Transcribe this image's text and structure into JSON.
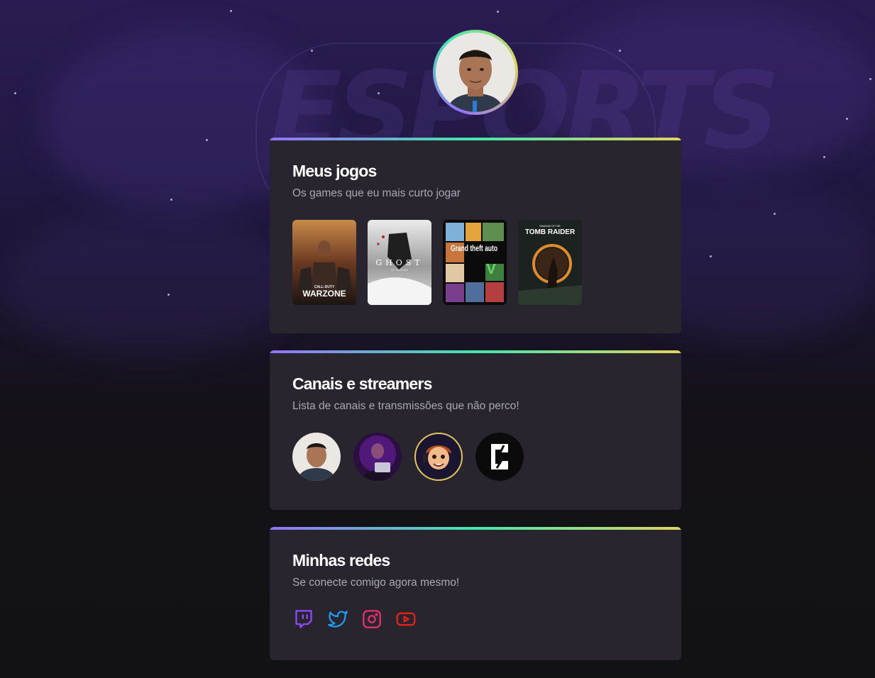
{
  "profile": {
    "avatar_alt": ""
  },
  "games_card": {
    "title": "Meus jogos",
    "subtitle": "Os games que eu mais curto jogar",
    "games": [
      {
        "cover_text": "WARZONE",
        "cover_subtext": "CALL·DUTY"
      },
      {
        "cover_text": "GHOST",
        "cover_subtext": "OF TSUSHIMA"
      },
      {
        "cover_text": "Grand theft auto",
        "cover_subtext": "V"
      },
      {
        "cover_text": "TOMB RAIDER",
        "cover_subtext": "SHADOW OF THE"
      }
    ]
  },
  "channels_card": {
    "title": "Canais e streamers",
    "subtitle": "Lista de canais e transmissões que não perco!"
  },
  "socials_card": {
    "title": "Minhas redes",
    "subtitle": "Se conecte comigo agora mesmo!",
    "icons": [
      "twitch-icon",
      "twitter-icon",
      "instagram-icon",
      "youtube-icon"
    ]
  },
  "colors": {
    "accent_gradient": [
      "#9572fc",
      "#43e7ad",
      "#e1d55d"
    ],
    "card_bg": "#28252f",
    "twitch": "#9147ff",
    "twitter": "#1d9bf0",
    "instagram": "#e1306c",
    "youtube": "#e62117"
  }
}
